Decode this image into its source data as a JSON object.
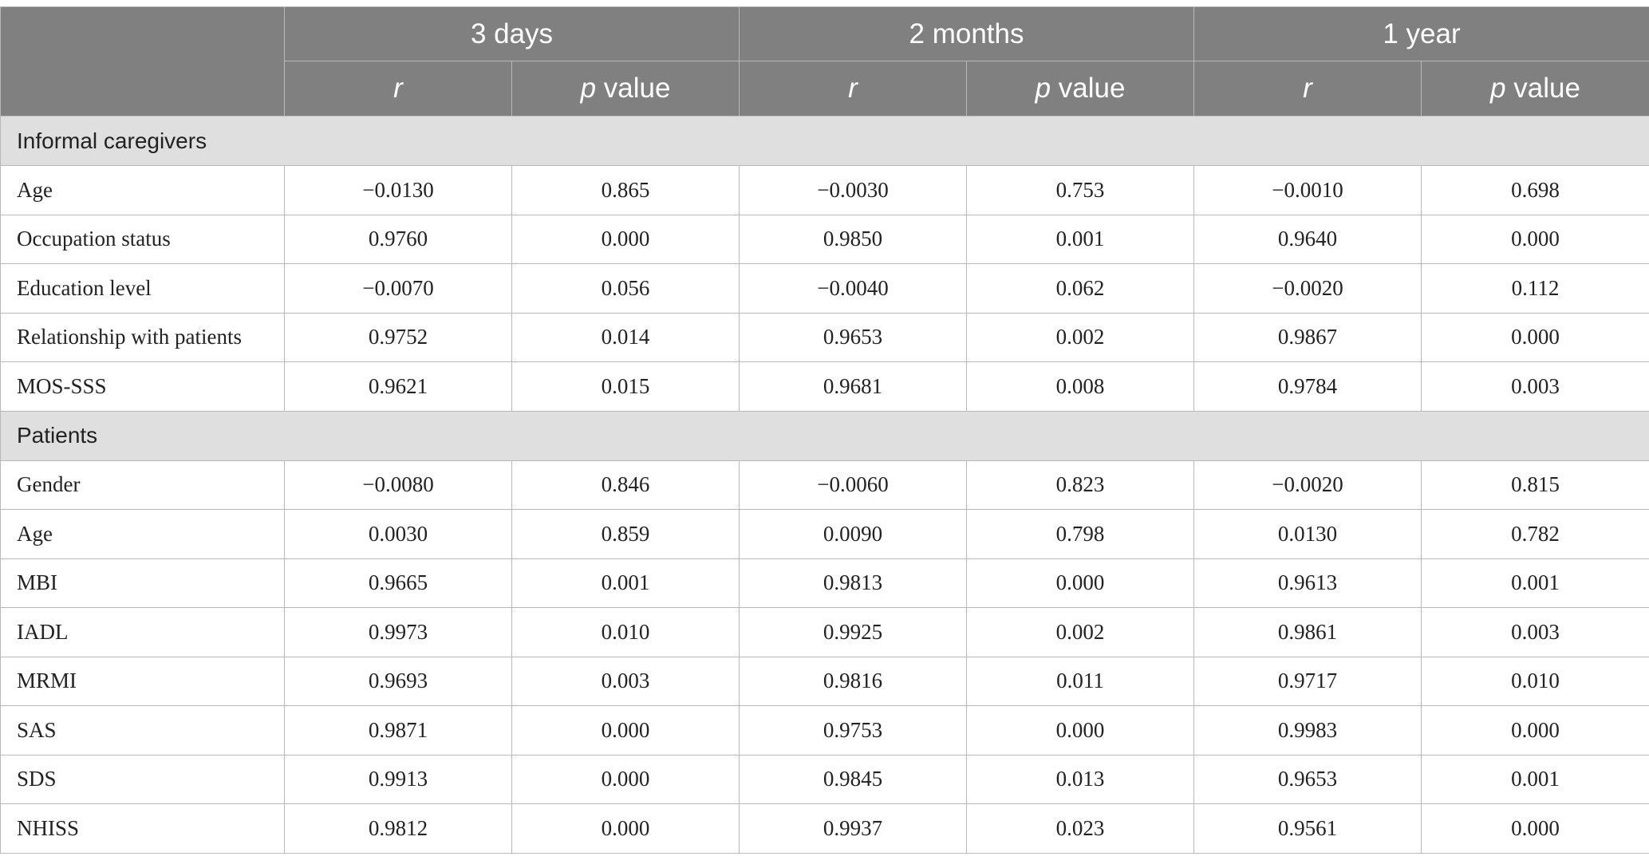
{
  "header": {
    "periods": [
      "3 days",
      "2 months",
      "1 year"
    ],
    "r_label": "r",
    "p_italic": "p",
    "p_rest": " value"
  },
  "sections": [
    {
      "title": "Informal caregivers",
      "rows": [
        {
          "label": "Age",
          "values": [
            "−0.0130",
            "0.865",
            "−0.0030",
            "0.753",
            "−0.0010",
            "0.698"
          ]
        },
        {
          "label": "Occupation status",
          "values": [
            "0.9760",
            "0.000",
            "0.9850",
            "0.001",
            "0.9640",
            "0.000"
          ]
        },
        {
          "label": "Education level",
          "values": [
            "−0.0070",
            "0.056",
            "−0.0040",
            "0.062",
            "−0.0020",
            "0.112"
          ]
        },
        {
          "label": "Relationship with patients",
          "values": [
            "0.9752",
            "0.014",
            "0.9653",
            "0.002",
            "0.9867",
            "0.000"
          ]
        },
        {
          "label": "MOS-SSS",
          "values": [
            "0.9621",
            "0.015",
            "0.9681",
            "0.008",
            "0.9784",
            "0.003"
          ]
        }
      ]
    },
    {
      "title": "Patients",
      "rows": [
        {
          "label": "Gender",
          "values": [
            "−0.0080",
            "0.846",
            "−0.0060",
            "0.823",
            "−0.0020",
            "0.815"
          ]
        },
        {
          "label": "Age",
          "values": [
            "0.0030",
            "0.859",
            "0.0090",
            "0.798",
            "0.0130",
            "0.782"
          ]
        },
        {
          "label": "MBI",
          "values": [
            "0.9665",
            "0.001",
            "0.9813",
            "0.000",
            "0.9613",
            "0.001"
          ]
        },
        {
          "label": "IADL",
          "values": [
            "0.9973",
            "0.010",
            "0.9925",
            "0.002",
            "0.9861",
            "0.003"
          ]
        },
        {
          "label": "MRMI",
          "values": [
            "0.9693",
            "0.003",
            "0.9816",
            "0.011",
            "0.9717",
            "0.010"
          ]
        },
        {
          "label": "SAS",
          "values": [
            "0.9871",
            "0.000",
            "0.9753",
            "0.000",
            "0.9983",
            "0.000"
          ]
        },
        {
          "label": "SDS",
          "values": [
            "0.9913",
            "0.000",
            "0.9845",
            "0.013",
            "0.9653",
            "0.001"
          ]
        },
        {
          "label": "NHISS",
          "values": [
            "0.9812",
            "0.000",
            "0.9937",
            "0.023",
            "0.9561",
            "0.000"
          ]
        }
      ]
    }
  ]
}
